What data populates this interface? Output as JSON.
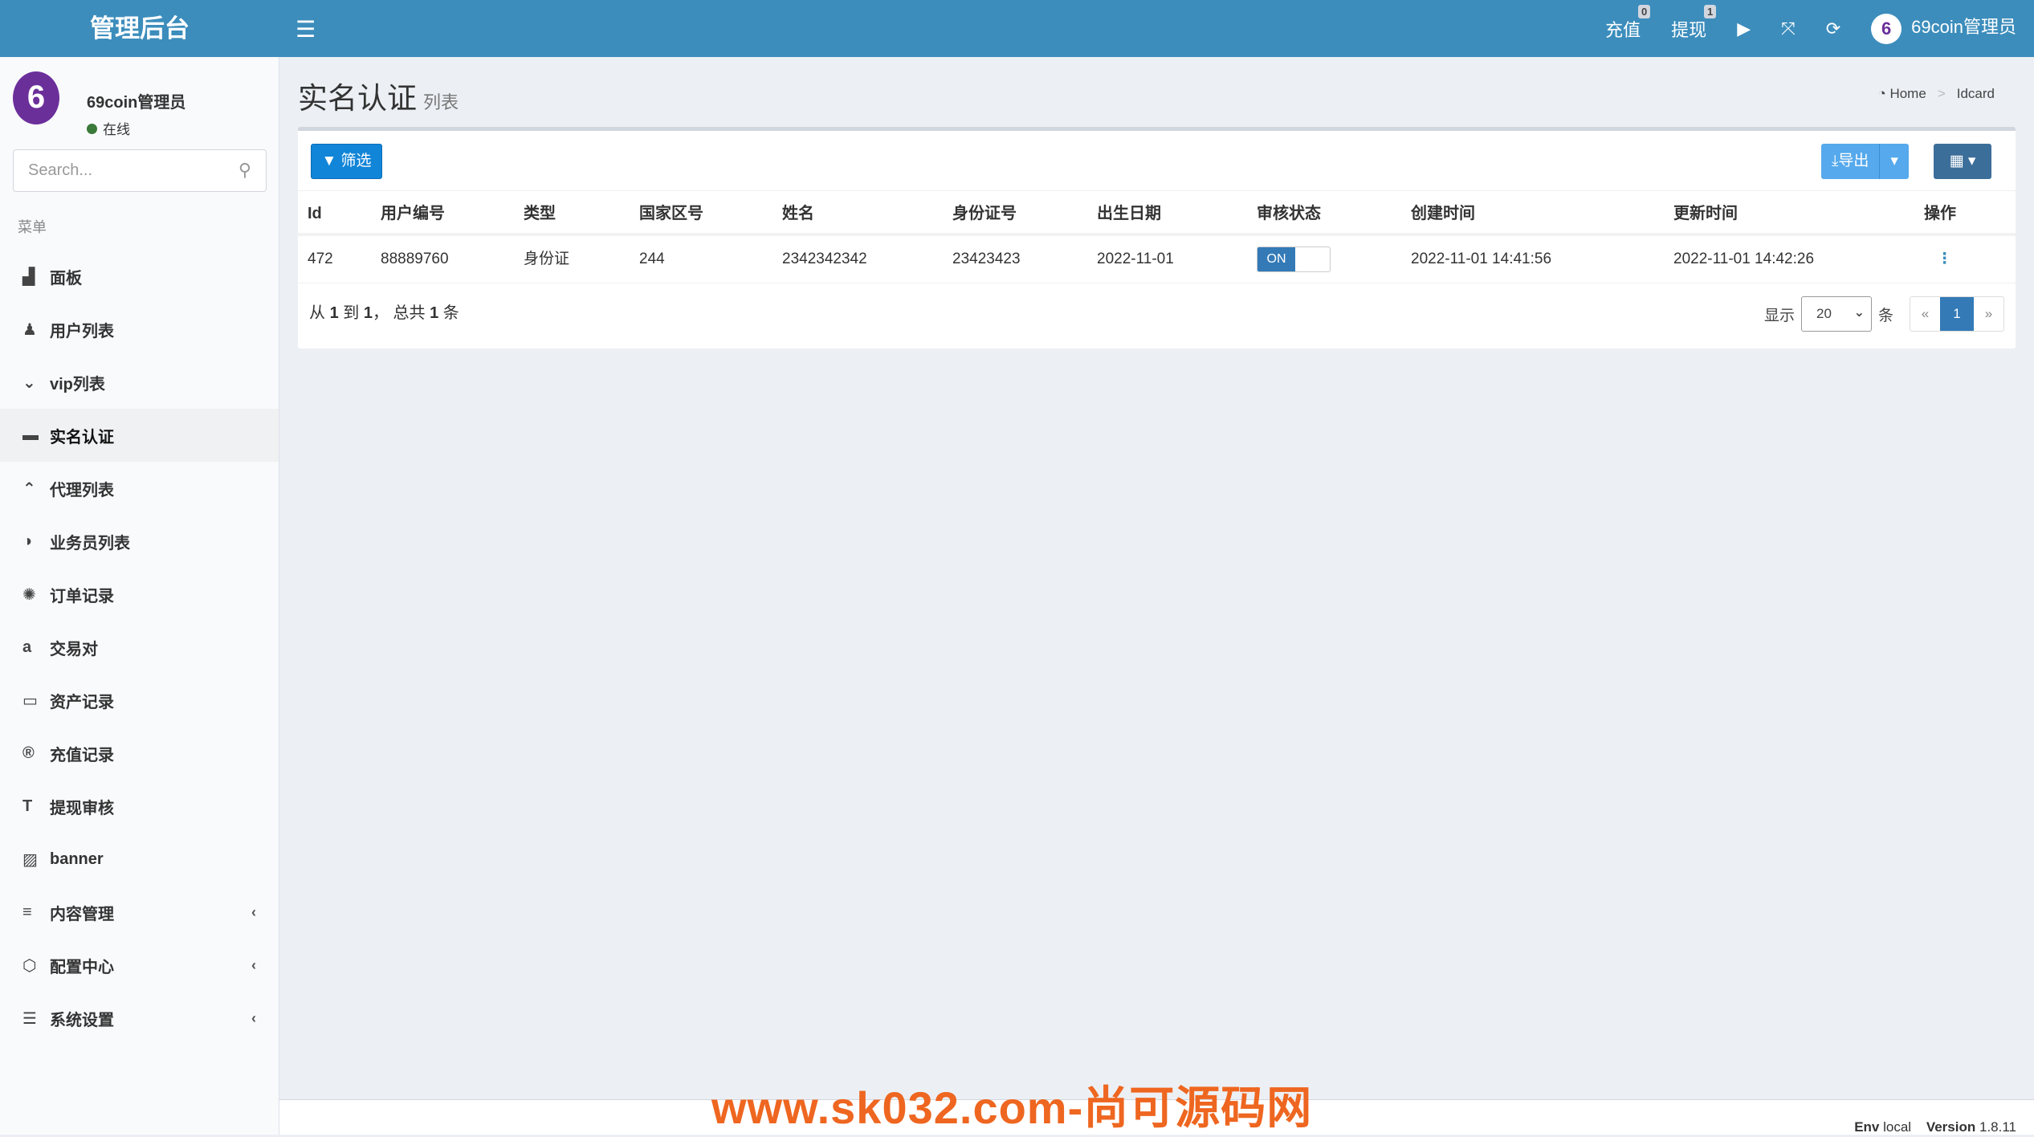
{
  "header": {
    "logo": "管理后台",
    "menu_icon": "bars-icon",
    "recharge": "充值",
    "recharge_badge": "0",
    "withdraw": "提现",
    "withdraw_badge": "1",
    "user": "69coin管理员"
  },
  "sidebar": {
    "user_name": "69coin管理员",
    "status": "在线",
    "search_placeholder": "Search...",
    "menu_header": "菜单",
    "items": [
      {
        "label": "面板",
        "icon": "area-chart-icon",
        "glyph": "▟"
      },
      {
        "label": "用户列表",
        "icon": "user-secret-icon",
        "glyph": "♟"
      },
      {
        "label": "vip列表",
        "icon": "chevron-circle-down-icon",
        "glyph": "⌄"
      },
      {
        "label": "实名认证",
        "icon": "credit-card-icon",
        "glyph": "▬",
        "active": true
      },
      {
        "label": "代理列表",
        "icon": "chevron-circle-up-icon",
        "glyph": "⌃"
      },
      {
        "label": "业务员列表",
        "icon": "adjust-icon",
        "glyph": "◑"
      },
      {
        "label": "订单记录",
        "icon": "empire-icon",
        "glyph": "✺"
      },
      {
        "label": "交易对",
        "icon": "amazon-icon",
        "glyph": "a"
      },
      {
        "label": "资产记录",
        "icon": "money-icon",
        "glyph": "▭"
      },
      {
        "label": "充值记录",
        "icon": "registered-icon",
        "glyph": "®"
      },
      {
        "label": "提现审核",
        "icon": "text-height-icon",
        "glyph": "T"
      },
      {
        "label": "banner",
        "icon": "image-icon",
        "glyph": "▨"
      },
      {
        "label": "内容管理",
        "icon": "bars-icon",
        "glyph": "≡",
        "sub": true
      },
      {
        "label": "配置中心",
        "icon": "connectdevelop-icon",
        "glyph": "⬡",
        "sub": true
      },
      {
        "label": "系统设置",
        "icon": "server-icon",
        "glyph": "☰",
        "sub": true
      }
    ]
  },
  "page": {
    "title": "实名认证",
    "subtitle": "列表",
    "breadcrumb": [
      "Home",
      "Idcard"
    ]
  },
  "toolbar": {
    "filter": "筛选",
    "export": "导出"
  },
  "table": {
    "columns": [
      "Id",
      "用户编号",
      "类型",
      "国家区号",
      "姓名",
      "身份证号",
      "出生日期",
      "审核状态",
      "创建时间",
      "更新时间",
      "操作"
    ],
    "rows": [
      {
        "id": "472",
        "user_no": "88889760",
        "type": "身份证",
        "country_code": "244",
        "name": "2342342342",
        "id_number": "23423423",
        "birth_date": "2022-11-01",
        "status": "ON",
        "status_on": true,
        "created": "2022-11-01 14:41:56",
        "updated": "2022-11-01 14:42:26"
      }
    ]
  },
  "pagination": {
    "summary_a": "从 ",
    "from": "1",
    "summary_b": " 到 ",
    "to": "1",
    "summary_c": "， 总共 ",
    "total": "1",
    "summary_d": " 条",
    "show": "显示",
    "per_page": "20",
    "unit": "条",
    "prev": "«",
    "current": "1",
    "next": "»"
  },
  "watermark": "www.sk032.com-尚可源码网",
  "footer": {
    "env_label": "Env",
    "env": "local",
    "version_label": "Version",
    "version": "1.8.11"
  }
}
